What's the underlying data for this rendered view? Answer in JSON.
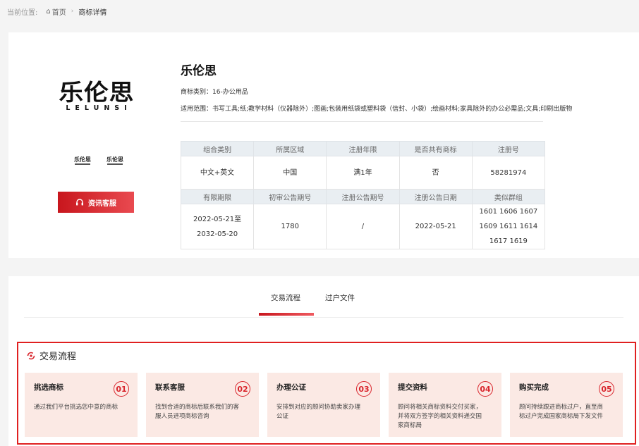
{
  "breadcrumb": {
    "label": "当前位置:",
    "home": "首页",
    "current": "商标详情"
  },
  "trademark": {
    "logo_cn": "乐伦思",
    "logo_en": "LELUNSI",
    "thumb_label": "乐伦思",
    "service_button": "资讯客服",
    "name": "乐伦思",
    "category": "商标类别：16-办公用品",
    "scope": "适用范围：书写工具;纸;教学材料（仪器除外）;图画;包装用纸袋或塑料袋（信封、小袋）;绘画材料;家具除外的办公必需品;文具;印刷出版物"
  },
  "info_table": {
    "headers1": [
      "组合类别",
      "所属区域",
      "注册年限",
      "是否共有商标",
      "注册号"
    ],
    "values1": [
      "中文+英文",
      "中国",
      "满1年",
      "否",
      "58281974"
    ],
    "headers2": [
      "有限期限",
      "初审公告期号",
      "注册公告期号",
      "注册公告日期",
      "类似群组"
    ],
    "values2": [
      "2022-05-21至2032-05-20",
      "1780",
      "/",
      "2022-05-21",
      "1601 1606 1607 1609 1611 1614 1617 1619"
    ]
  },
  "tabs": [
    "交易流程",
    "过户文件"
  ],
  "flow": {
    "title": "交易流程",
    "steps": [
      {
        "title": "挑选商标",
        "num": "01",
        "desc": "通过我们平台挑选您中意的商标"
      },
      {
        "title": "联系客服",
        "num": "02",
        "desc": "找到合适的商标后联系我们的客服人员进项商标咨询"
      },
      {
        "title": "办理公证",
        "num": "03",
        "desc": "安排到对应的顾问协助卖家办理公证"
      },
      {
        "title": "提交资料",
        "num": "04",
        "desc": "顾问将相关商标资料交付买家，并将双方签字的相关资料递交国家商标局"
      },
      {
        "title": "购买完成",
        "num": "05",
        "desc": "顾问持续跟进商标过户，直至商标过户完成国家商标局下发文件"
      }
    ]
  },
  "colors": {
    "accent": "#d9252c",
    "step_bg": "#fbe9e4"
  }
}
